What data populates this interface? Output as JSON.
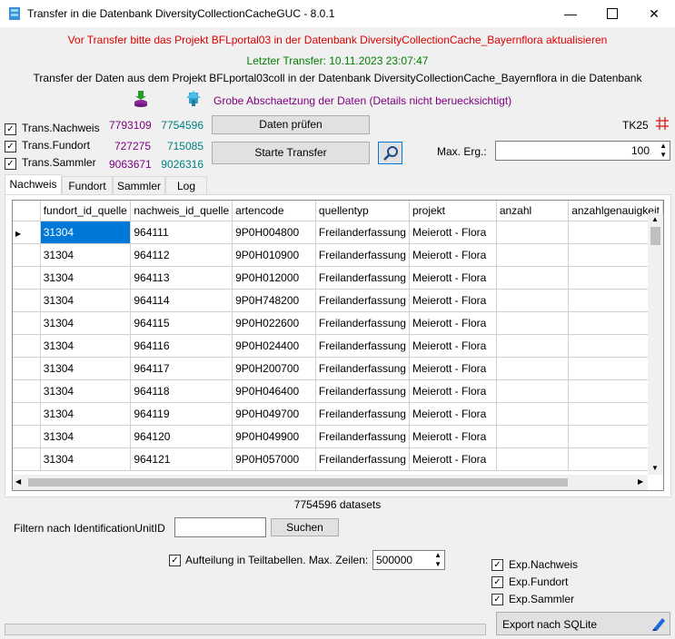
{
  "window": {
    "title": "Transfer in die Datenbank DiversityCollectionCacheGUC - 8.0.1"
  },
  "messages": {
    "warning": "Vor Transfer bitte das Projekt BFLportal03 in der Datenbank DiversityCollectionCache_Bayernflora aktualisieren",
    "last_transfer": "Letzter Transfer: 10.11.2023 23:07:47",
    "info": "Transfer der Daten aus dem Projekt BFLportal03coll in der Datenbank DiversityCollectionCache_Bayernflora in die Datenbank",
    "estimate": "Grobe Abschaetzung der Daten (Details nicht beruecksichtigt)"
  },
  "transfer_options": [
    {
      "label": "Trans.Nachweis",
      "checked": true,
      "count_source": "7793109",
      "count_target": "7754596"
    },
    {
      "label": "Trans.Fundort",
      "checked": true,
      "count_source": "727275",
      "count_target": "715085"
    },
    {
      "label": "Trans.Sammler",
      "checked": true,
      "count_source": "9063671",
      "count_target": "9026316"
    }
  ],
  "buttons": {
    "check": "Daten prüfen",
    "start": "Starte Transfer",
    "search": "Suchen",
    "export": "Export nach SQLite"
  },
  "tk25": {
    "label": "TK25"
  },
  "max_results": {
    "label": "Max. Erg.:",
    "value": "100"
  },
  "tabs": [
    "Nachweis",
    "Fundort",
    "Sammler",
    "Log"
  ],
  "grid": {
    "columns": [
      "fundort_id_quelle",
      "nachweis_id_quelle",
      "artencode",
      "quellentyp",
      "projekt",
      "anzahl",
      "anzahlgenauigkeit"
    ],
    "rows": [
      [
        "31304",
        "964111",
        "9P0H004800",
        "Freilanderfassung",
        "Meierott - Flora",
        "",
        ""
      ],
      [
        "31304",
        "964112",
        "9P0H010900",
        "Freilanderfassung",
        "Meierott - Flora",
        "",
        ""
      ],
      [
        "31304",
        "964113",
        "9P0H012000",
        "Freilanderfassung",
        "Meierott - Flora",
        "",
        ""
      ],
      [
        "31304",
        "964114",
        "9P0H748200",
        "Freilanderfassung",
        "Meierott - Flora",
        "",
        ""
      ],
      [
        "31304",
        "964115",
        "9P0H022600",
        "Freilanderfassung",
        "Meierott - Flora",
        "",
        ""
      ],
      [
        "31304",
        "964116",
        "9P0H024400",
        "Freilanderfassung",
        "Meierott - Flora",
        "",
        ""
      ],
      [
        "31304",
        "964117",
        "9P0H200700",
        "Freilanderfassung",
        "Meierott - Flora",
        "",
        ""
      ],
      [
        "31304",
        "964118",
        "9P0H046400",
        "Freilanderfassung",
        "Meierott - Flora",
        "",
        ""
      ],
      [
        "31304",
        "964119",
        "9P0H049700",
        "Freilanderfassung",
        "Meierott - Flora",
        "",
        ""
      ],
      [
        "31304",
        "964120",
        "9P0H049900",
        "Freilanderfassung",
        "Meierott - Flora",
        "",
        ""
      ],
      [
        "31304",
        "964121",
        "9P0H057000",
        "Freilanderfassung",
        "Meierott - Flora",
        "",
        ""
      ]
    ]
  },
  "datasets_count": "7754596 datasets",
  "filter": {
    "label": "Filtern nach IdentificationUnitID",
    "value": ""
  },
  "split": {
    "label": "Aufteilung in Teiltabellen. Max. Zeilen:",
    "value": "500000",
    "checked": true
  },
  "exports": [
    {
      "label": "Exp.Nachweis",
      "checked": true
    },
    {
      "label": "Exp.Fundort",
      "checked": true
    },
    {
      "label": "Exp.Sammler",
      "checked": true
    }
  ],
  "colors": {
    "warning": "#e00000",
    "last_transfer": "#008000",
    "estimate": "#800080",
    "count_source": "#800080",
    "count_target": "#008080",
    "selection": "#0078d7"
  },
  "icons": {
    "app": "database-icon",
    "upload": "database-upload-icon",
    "estimate": "tree-icon",
    "grid": "grid-icon",
    "search": "magnifier-icon",
    "export": "pen-icon"
  }
}
